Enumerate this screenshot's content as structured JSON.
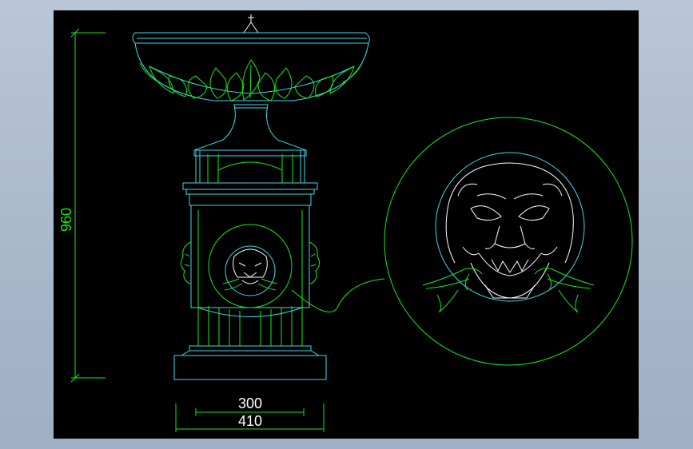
{
  "drawing": {
    "background": "#000000",
    "line_colors": {
      "green": "#19e61e",
      "cyan": "#44d7e6",
      "white": "#ffffff"
    },
    "dimensions": {
      "height_label": "960",
      "inner_width_label": "300",
      "outer_width_label": "410"
    }
  }
}
